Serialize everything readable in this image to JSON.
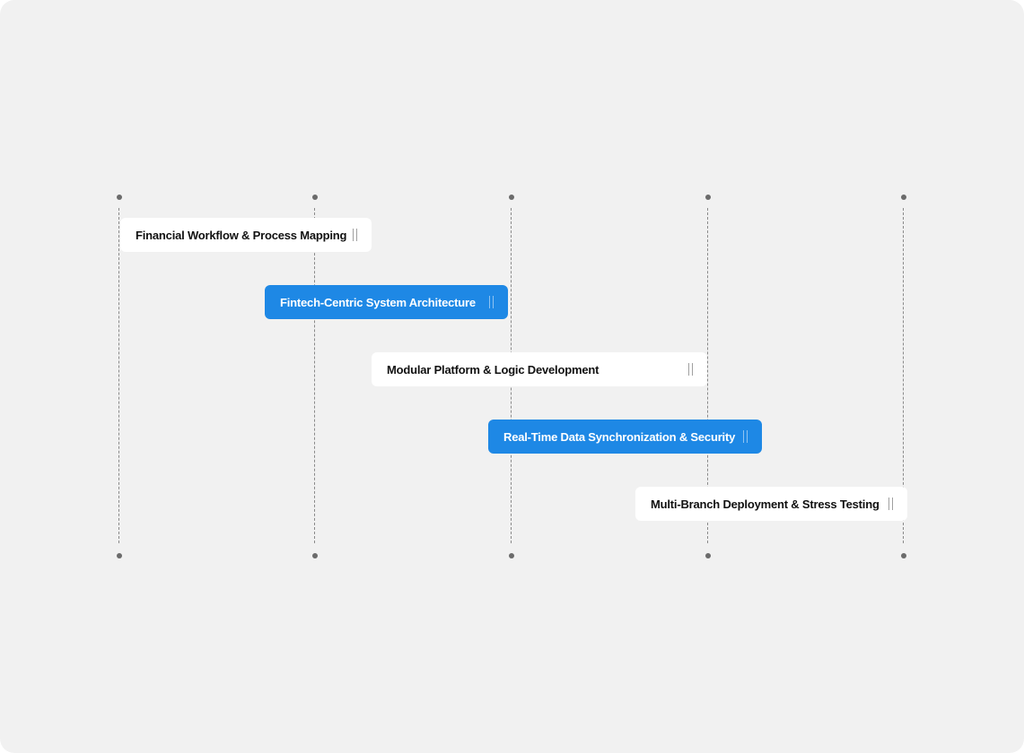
{
  "colors": {
    "canvas": "#f1f1f1",
    "accent": "#1e88e5",
    "card": "#ffffff",
    "guide": "#8a8a8a"
  },
  "guides": {
    "count": 5
  },
  "tasks": [
    {
      "label": "Financial Workflow & Process Mapping",
      "style": "white",
      "start_step": 0,
      "end_step": 1.28,
      "handle_icon": "drag-handle-icon"
    },
    {
      "label": "Fintech-Centric System Architecture",
      "style": "blue",
      "start_step": 0.74,
      "end_step": 1.99,
      "handle_icon": "drag-handle-icon"
    },
    {
      "label": "Modular Platform & Logic Development",
      "style": "white",
      "start_step": 1.29,
      "end_step": 3.0,
      "handle_icon": "drag-handle-icon"
    },
    {
      "label": "Real-Time Data Synchronization & Security",
      "style": "blue",
      "start_step": 1.88,
      "end_step": 3.28,
      "handle_icon": "drag-handle-icon"
    },
    {
      "label": "Multi-Branch Deployment & Stress Testing",
      "style": "white",
      "start_step": 2.64,
      "end_step": 4.02,
      "handle_icon": "drag-handle-icon"
    }
  ]
}
